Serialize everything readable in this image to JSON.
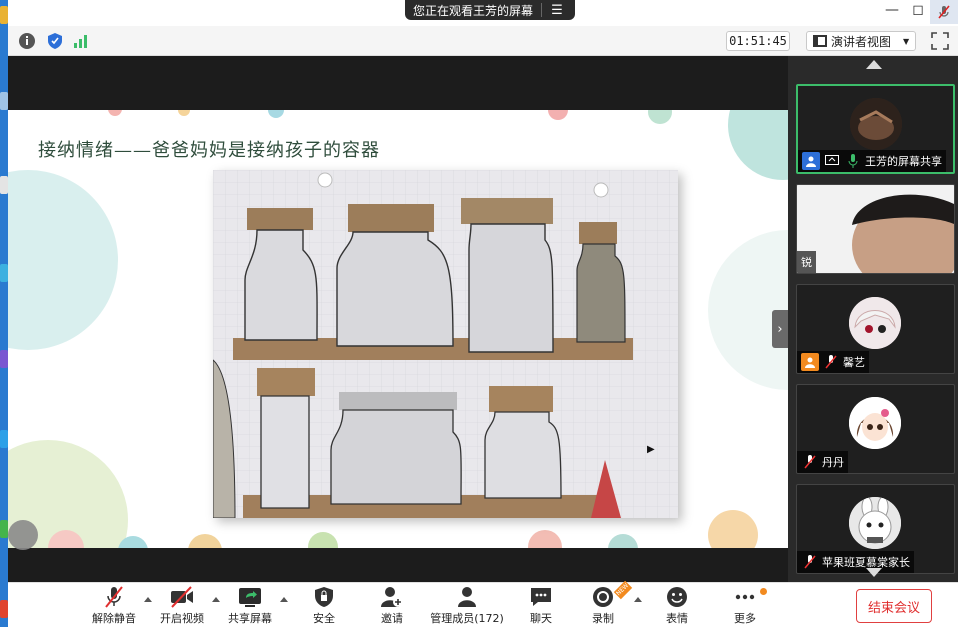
{
  "titlebar": {
    "viewing_text": "您正在观看王芳的屏幕"
  },
  "info": {
    "timer": "01:51:45",
    "view_label": "演讲者视图"
  },
  "slide": {
    "title": "接纳情绪——爸爸妈妈是接纳孩子的容器"
  },
  "gallery": {
    "tiles": [
      {
        "name": "王芳的屏幕共享",
        "active": true
      },
      {
        "name": "锐"
      },
      {
        "name": "馨艺"
      },
      {
        "name": "丹丹"
      },
      {
        "name": "苹果班夏慕棠家长"
      }
    ]
  },
  "toolbar": {
    "unmute": "解除静音",
    "start_video": "开启视频",
    "share_screen": "共享屏幕",
    "security": "安全",
    "invite": "邀请",
    "participants": "管理成员(172)",
    "chat": "聊天",
    "record": "录制",
    "reactions": "表情",
    "more": "更多",
    "end_meeting": "结束会议",
    "new_badge": "NEW"
  },
  "colors": {
    "accent_green": "#3cbd6a",
    "end_red": "#e02f2f",
    "badge_orange": "#f28a1f"
  }
}
